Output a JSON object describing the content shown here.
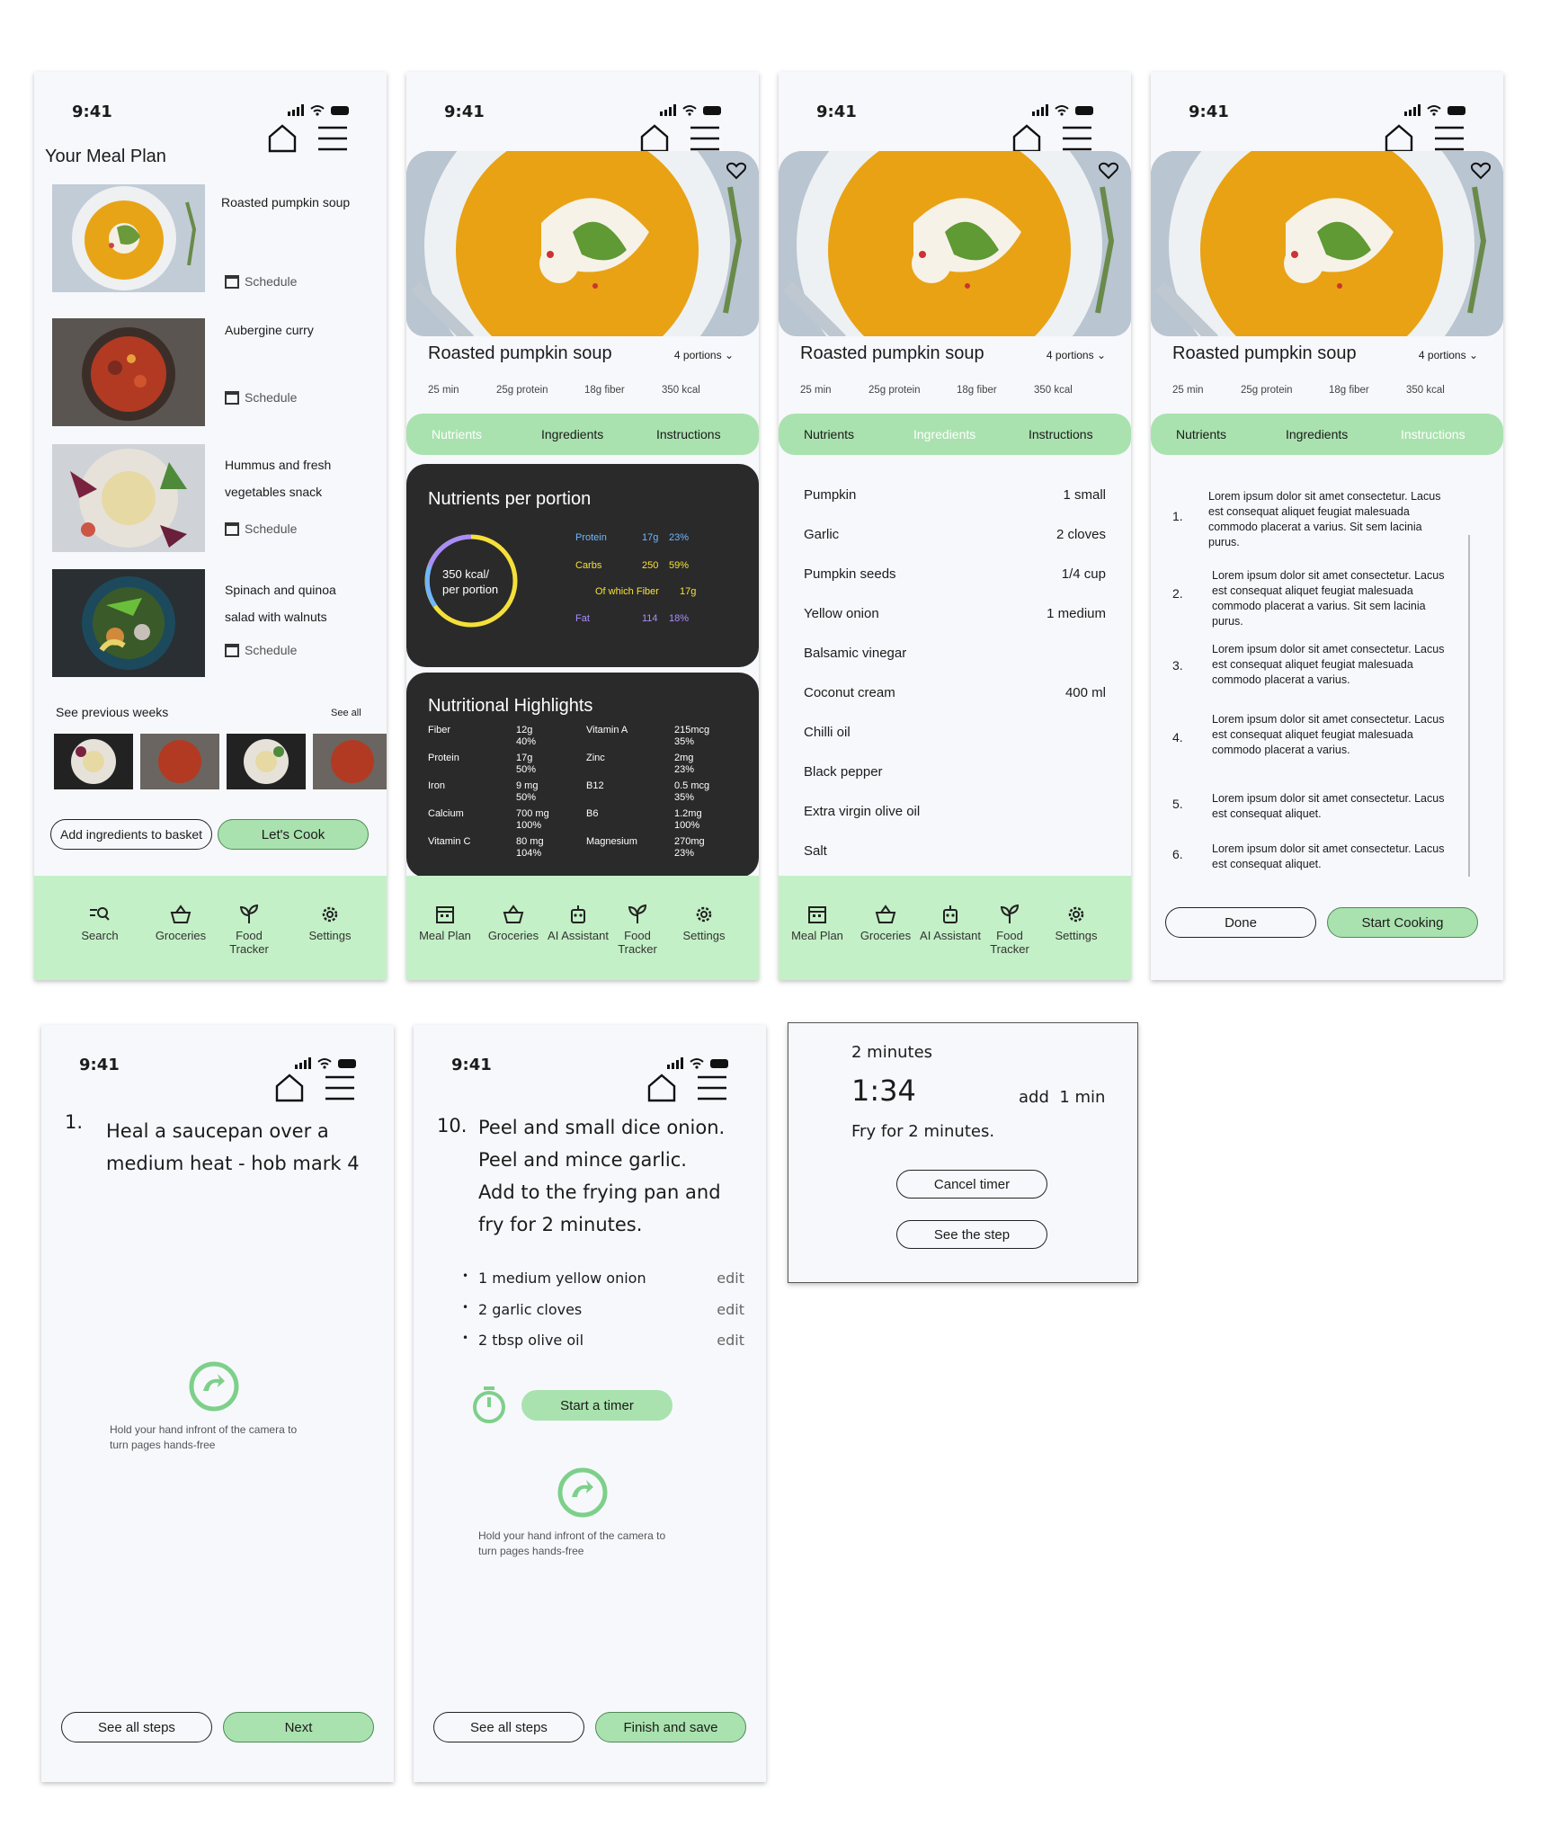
{
  "status_time": "9:41",
  "meal_plan": {
    "title": "Your Meal Plan",
    "items": [
      {
        "name_lines": [
          "Roasted pumpkin soup"
        ],
        "schedule": "Schedule"
      },
      {
        "name_lines": [
          "Aubergine curry"
        ],
        "schedule": "Schedule"
      },
      {
        "name_lines": [
          "Hummus and fresh",
          "vegetables snack"
        ],
        "schedule": "Schedule"
      },
      {
        "name_lines": [
          "Spinach and quinoa",
          "salad with walnuts"
        ],
        "schedule": "Schedule"
      }
    ],
    "previous_weeks": "See previous weeks",
    "see_all": "See all",
    "add_basket": "Add ingredients to basket",
    "lets_cook": "Let's Cook",
    "nav": [
      "Search",
      "Groceries",
      "Food Tracker",
      "Settings"
    ]
  },
  "recipe": {
    "title": "Roasted pumpkin soup",
    "portions": "4 portions",
    "meta": [
      "25 min",
      "25g protein",
      "18g fiber",
      "350 kcal"
    ],
    "tabs": [
      "Nutrients",
      "Ingredients",
      "Instructions"
    ]
  },
  "nutrients": {
    "title": "Nutrients per portion",
    "ring_line1": "350 kcal/",
    "ring_line2": "per portion",
    "macros": [
      {
        "label": "Protein",
        "amount": "17g",
        "pct": "23%",
        "color": "#6fb6ff"
      },
      {
        "label": "Carbs",
        "amount": "250",
        "pct": "59%",
        "color": "#f5e03a"
      },
      {
        "label": "Of which Fiber",
        "amount": "17g",
        "pct": "",
        "color": "#f5e03a"
      },
      {
        "label": "Fat",
        "amount": "114",
        "pct": "18%",
        "color": "#a98cff"
      }
    ]
  },
  "highlights": {
    "title": "Nutritional Highlights",
    "left": [
      {
        "label": "Fiber",
        "v1": "12g",
        "v2": "40%"
      },
      {
        "label": "Protein",
        "v1": "17g",
        "v2": "50%"
      },
      {
        "label": "Iron",
        "v1": "9 mg",
        "v2": "50%"
      },
      {
        "label": "Calcium",
        "v1": "700 mg",
        "v2": "100%"
      },
      {
        "label": "Vitamin C",
        "v1": "80 mg",
        "v2": "104%"
      }
    ],
    "right": [
      {
        "label": "Vitamin A",
        "v1": "215mcg",
        "v2": "35%"
      },
      {
        "label": "Zinc",
        "v1": "2mg",
        "v2": "23%"
      },
      {
        "label": "B12",
        "v1": "0.5 mcg",
        "v2": "35%"
      },
      {
        "label": "B6",
        "v1": "1.2mg",
        "v2": "100%"
      },
      {
        "label": "Magnesium",
        "v1": "270mg",
        "v2": "23%"
      }
    ]
  },
  "nav_full": [
    "Meal Plan",
    "Groceries",
    "AI Assistant",
    "Food Tracker",
    "Settings"
  ],
  "ingredients": [
    {
      "name": "Pumpkin",
      "qty": "1 small"
    },
    {
      "name": "Garlic",
      "qty": "2 cloves"
    },
    {
      "name": "Pumpkin seeds",
      "qty": "1/4 cup"
    },
    {
      "name": "Yellow onion",
      "qty": "1 medium"
    },
    {
      "name": "Balsamic vinegar",
      "qty": ""
    },
    {
      "name": "Coconut cream",
      "qty": "400 ml"
    },
    {
      "name": "Chilli oil",
      "qty": ""
    },
    {
      "name": "Black pepper",
      "qty": ""
    },
    {
      "name": "Extra virgin olive oil",
      "qty": ""
    },
    {
      "name": "Salt",
      "qty": ""
    }
  ],
  "instructions": [
    {
      "n": "1.",
      "text": "Lorem ipsum dolor sit amet consectetur. Lacus est consequat aliquet feugiat malesuada commodo placerat a varius. Sit sem lacinia purus."
    },
    {
      "n": "2.",
      "text": "Lorem ipsum dolor sit amet consectetur. Lacus est consequat aliquet feugiat malesuada commodo placerat a varius. Sit sem lacinia purus."
    },
    {
      "n": "3.",
      "text": "Lorem ipsum dolor sit amet consectetur. Lacus est consequat aliquet feugiat malesuada commodo placerat a varius."
    },
    {
      "n": "4.",
      "text": "Lorem ipsum dolor sit amet consectetur. Lacus est consequat aliquet feugiat malesuada commodo placerat a varius."
    },
    {
      "n": "5.",
      "text": "Lorem ipsum dolor sit amet consectetur. Lacus est consequat aliquet."
    },
    {
      "n": "6.",
      "text": "Lorem ipsum dolor sit amet consectetur. Lacus est consequat aliquet."
    }
  ],
  "instr_done": "Done",
  "instr_start": "Start Cooking",
  "step1": {
    "num": "1.",
    "lines": [
      "Heal a saucepan over a",
      "medium heat - hob mark 4"
    ],
    "hint_lines": [
      "Hold your hand infront of the camera to",
      "turn pages hands-free"
    ],
    "see_all": "See all steps",
    "next": "Next"
  },
  "step10": {
    "num": "10.",
    "lines": [
      "Peel and small dice onion.",
      "Peel and mince garlic.",
      "Add to the frying pan and",
      "fry for 2 minutes."
    ],
    "items": [
      "1 medium yellow onion",
      "2 garlic cloves",
      "2 tbsp olive oil"
    ],
    "edit": "edit",
    "timer": "Start a timer",
    "hint_lines": [
      "Hold your hand infront of the camera to",
      "turn pages hands-free"
    ],
    "see_all": "See all steps",
    "finish": "Finish and save"
  },
  "timer": {
    "duration": "2 minutes",
    "remaining": "1:34",
    "add": "add  1 min",
    "desc": "Fry for 2 minutes.",
    "cancel": "Cancel timer",
    "see_step": "See the step"
  },
  "colors": {
    "accent_green": "#a9e2ae",
    "nav_green": "#c3f0c6",
    "dark_card": "#2a2a2a"
  }
}
